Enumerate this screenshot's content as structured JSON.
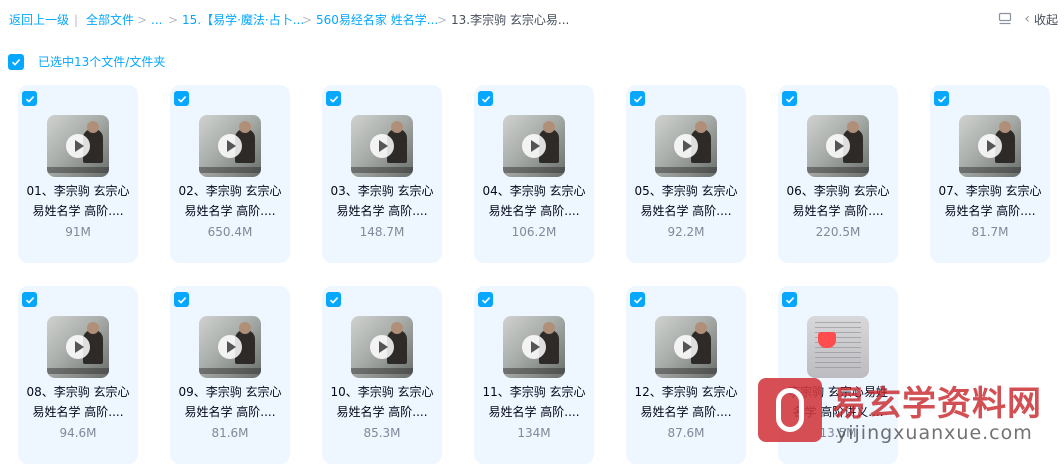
{
  "breadcrumb": {
    "back": "返回上一级",
    "separator": "|",
    "all_files": "全部文件",
    "chevron": ">",
    "ellipsis": "...",
    "folder1": "15.【易学·魔法·占卜...",
    "folder2": "560易经名家 姓名学...",
    "current": "13.李宗驹 玄宗心易..."
  },
  "toolbar": {
    "collapse_label": "收起"
  },
  "selection": {
    "label": "已选中13个文件/文件夹"
  },
  "files": [
    {
      "line1": "01、李宗驹 玄宗心",
      "line2": "易姓名学 高阶....",
      "size": "91M"
    },
    {
      "line1": "02、李宗驹 玄宗心",
      "line2": "易姓名学 高阶....",
      "size": "650.4M"
    },
    {
      "line1": "03、李宗驹 玄宗心",
      "line2": "易姓名学 高阶....",
      "size": "148.7M"
    },
    {
      "line1": "04、李宗驹 玄宗心",
      "line2": "易姓名学 高阶....",
      "size": "106.2M"
    },
    {
      "line1": "05、李宗驹 玄宗心",
      "line2": "易姓名学 高阶....",
      "size": "92.2M"
    },
    {
      "line1": "06、李宗驹 玄宗心",
      "line2": "易姓名学 高阶....",
      "size": "220.5M"
    },
    {
      "line1": "07、李宗驹 玄宗心",
      "line2": "易姓名学 高阶....",
      "size": "81.7M"
    },
    {
      "line1": "08、李宗驹 玄宗心",
      "line2": "易姓名学 高阶....",
      "size": "94.6M"
    },
    {
      "line1": "09、李宗驹 玄宗心",
      "line2": "易姓名学 高阶....",
      "size": "81.6M"
    },
    {
      "line1": "10、李宗驹 玄宗心",
      "line2": "易姓名学 高阶....",
      "size": "85.3M"
    },
    {
      "line1": "11、李宗驹 玄宗心",
      "line2": "易姓名学 高阶....",
      "size": "134M"
    },
    {
      "line1": "12、李宗驹 玄宗心",
      "line2": "易姓名学 高阶....",
      "size": "87.6M"
    },
    {
      "line1": "李宗驹 玄宗心易姓",
      "line2": "名学 高阶讲义....",
      "size": "13.5M"
    }
  ],
  "watermark": {
    "title": "易玄学资料网",
    "url": "yijingxuanxue.com"
  },
  "colors": {
    "accent": "#06a7ff",
    "card_bg": "#eef6ff",
    "size_text": "#818999",
    "pdf_red": "#ff4d4f"
  },
  "icons": {
    "list_view": "list-view-icon",
    "collapse": "chevron-left-icon",
    "checkbox": "checkbox-checked-icon",
    "play": "play-icon",
    "pdf": "pdf-icon"
  }
}
